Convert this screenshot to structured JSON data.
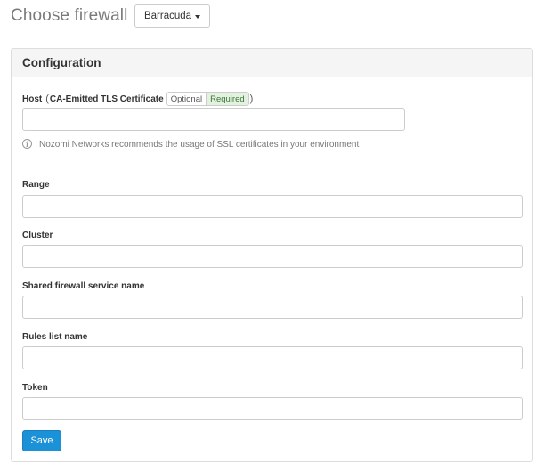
{
  "header": {
    "title": "Choose firewall",
    "firewall_selected": "Barracuda"
  },
  "panel": {
    "title": "Configuration"
  },
  "form": {
    "host": {
      "label": "Host",
      "paren_open": "(",
      "cert_label": "CA-Emitted TLS Certificate",
      "option_optional": "Optional",
      "option_required": "Required",
      "paren_close": ")",
      "value": "",
      "help_text": "Nozomi Networks recommends the usage of SSL certificates in your environment"
    },
    "range": {
      "label": "Range",
      "value": ""
    },
    "cluster": {
      "label": "Cluster",
      "value": ""
    },
    "shared_service": {
      "label": "Shared firewall service name",
      "value": ""
    },
    "rules_list": {
      "label": "Rules list name",
      "value": ""
    },
    "token": {
      "label": "Token",
      "value": ""
    },
    "save_label": "Save"
  },
  "colors": {
    "primary": "#1b91d8",
    "required_bg": "#e3f1df",
    "required_text": "#3c763d"
  }
}
